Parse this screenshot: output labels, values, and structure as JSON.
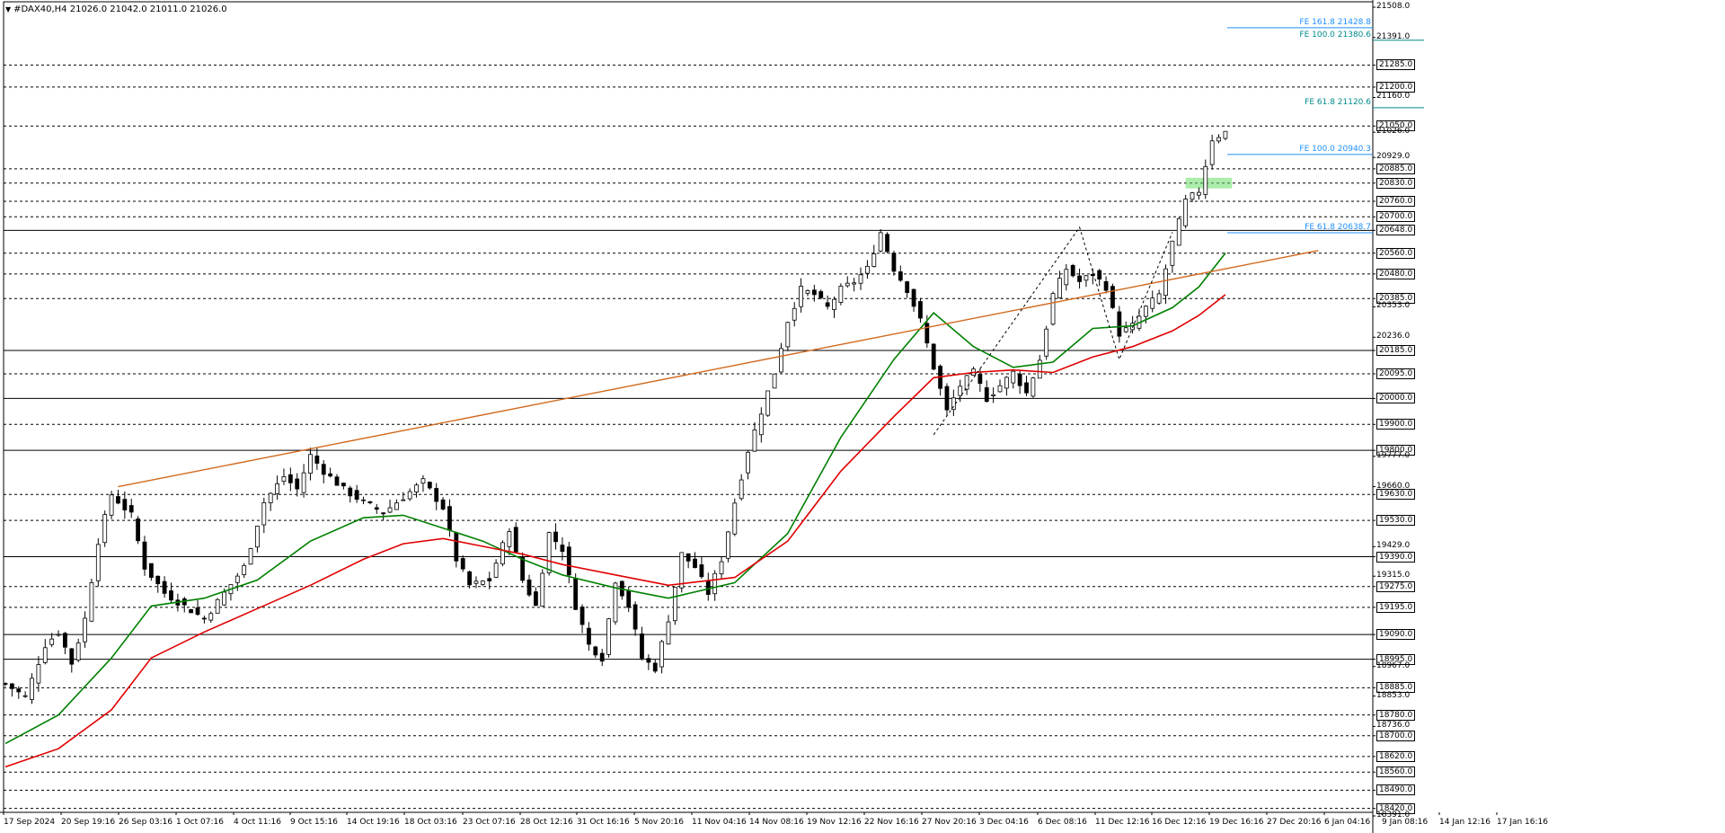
{
  "header": {
    "symbol_text": "#DAX40,H4  21026.0  21042.0  21011.0  21026.0"
  },
  "price_axis": {
    "labels": [
      {
        "text": "21508.0",
        "price": 21508.0,
        "boxed": false
      },
      {
        "text": "21391.0",
        "price": 21391.0,
        "boxed": false
      },
      {
        "text": "21285.0",
        "price": 21285.0,
        "boxed": true
      },
      {
        "text": "21200.0",
        "price": 21200.0,
        "boxed": true
      },
      {
        "text": "21160.0",
        "price": 21160.0,
        "boxed": false
      },
      {
        "text": "21050.0",
        "price": 21050.0,
        "boxed": true
      },
      {
        "text": "21026.0",
        "price": 21026.0,
        "boxed": false
      },
      {
        "text": "20929.0",
        "price": 20929.0,
        "boxed": false
      },
      {
        "text": "20885.0",
        "price": 20885.0,
        "boxed": true
      },
      {
        "text": "20830.0",
        "price": 20830.0,
        "boxed": true
      },
      {
        "text": "20760.0",
        "price": 20760.0,
        "boxed": true
      },
      {
        "text": "20700.0",
        "price": 20700.0,
        "boxed": true
      },
      {
        "text": "20648.0",
        "price": 20648.0,
        "boxed": true
      },
      {
        "text": "20560.0",
        "price": 20560.0,
        "boxed": true
      },
      {
        "text": "20480.0",
        "price": 20480.0,
        "boxed": true
      },
      {
        "text": "20385.0",
        "price": 20385.0,
        "boxed": true
      },
      {
        "text": "20353.0",
        "price": 20353.0,
        "boxed": false
      },
      {
        "text": "20236.0",
        "price": 20236.0,
        "boxed": false
      },
      {
        "text": "20185.0",
        "price": 20185.0,
        "boxed": true
      },
      {
        "text": "20095.0",
        "price": 20095.0,
        "boxed": true
      },
      {
        "text": "20000.0",
        "price": 20000.0,
        "boxed": true
      },
      {
        "text": "19900.0",
        "price": 19900.0,
        "boxed": true
      },
      {
        "text": "19800.0",
        "price": 19800.0,
        "boxed": true
      },
      {
        "text": "19777.0",
        "price": 19777.0,
        "boxed": false
      },
      {
        "text": "19660.0",
        "price": 19660.0,
        "boxed": false
      },
      {
        "text": "19630.0",
        "price": 19630.0,
        "boxed": true
      },
      {
        "text": "19530.0",
        "price": 19530.0,
        "boxed": true
      },
      {
        "text": "19429.0",
        "price": 19429.0,
        "boxed": false
      },
      {
        "text": "19390.0",
        "price": 19390.0,
        "boxed": true
      },
      {
        "text": "19315.0",
        "price": 19315.0,
        "boxed": false
      },
      {
        "text": "19275.0",
        "price": 19275.0,
        "boxed": true
      },
      {
        "text": "19195.0",
        "price": 19195.0,
        "boxed": true
      },
      {
        "text": "19090.0",
        "price": 19090.0,
        "boxed": true
      },
      {
        "text": "18995.0",
        "price": 18995.0,
        "boxed": true
      },
      {
        "text": "18967.0",
        "price": 18967.0,
        "boxed": false
      },
      {
        "text": "18885.0",
        "price": 18885.0,
        "boxed": true
      },
      {
        "text": "18853.0",
        "price": 18853.0,
        "boxed": false
      },
      {
        "text": "18780.0",
        "price": 18780.0,
        "boxed": true
      },
      {
        "text": "18736.0",
        "price": 18736.0,
        "boxed": false
      },
      {
        "text": "18700.0",
        "price": 18700.0,
        "boxed": true
      },
      {
        "text": "18620.0",
        "price": 18620.0,
        "boxed": true
      },
      {
        "text": "18560.0",
        "price": 18560.0,
        "boxed": true
      },
      {
        "text": "18490.0",
        "price": 18490.0,
        "boxed": true
      },
      {
        "text": "18420.0",
        "price": 18420.0,
        "boxed": true
      },
      {
        "text": "18391.0",
        "price": 18391.0,
        "boxed": false
      }
    ]
  },
  "time_axis": {
    "labels": [
      "17 Sep 2024",
      "20 Sep 19:16",
      "26 Sep 03:16",
      "1 Oct 07:16",
      "4 Oct 11:16",
      "9 Oct 15:16",
      "14 Oct 19:16",
      "18 Oct 03:16",
      "23 Oct 07:16",
      "28 Oct 12:16",
      "31 Oct 16:16",
      "5 Nov 20:16",
      "11 Nov 04:16",
      "14 Nov 08:16",
      "19 Nov 12:16",
      "22 Nov 16:16",
      "27 Nov 20:16",
      "3 Dec 04:16",
      "6 Dec 08:16",
      "11 Dec 12:16",
      "16 Dec 12:16",
      "19 Dec 16:16",
      "27 Dec 20:16",
      "6 Jan 04:16",
      "9 Jan 08:16",
      "14 Jan 12:16",
      "17 Jan 16:16"
    ]
  },
  "levels": {
    "dashed": [
      21285,
      21200,
      21050,
      20885,
      20830,
      20760,
      20700,
      20560,
      20480,
      20385,
      20095,
      19900,
      19630,
      19530,
      19275,
      19195,
      18885,
      18780,
      18700,
      18620,
      18560,
      18490,
      18420
    ],
    "solid": [
      20648,
      20185,
      20000,
      19800,
      19390,
      19090,
      18995
    ]
  },
  "fibonacci": [
    {
      "text": "FE 161.8 21428.8",
      "price": 21428.8,
      "color": "#1e90ff"
    },
    {
      "text": "FE 100.0 21380.6",
      "price": 21380.6,
      "color": "#008b8b"
    },
    {
      "text": "FE 61.8 21120.6",
      "price": 21120.6,
      "color": "#008b8b"
    },
    {
      "text": "FE 100.0 20940.3",
      "price": 20940.3,
      "color": "#1e90ff"
    },
    {
      "text": "FE 61.8 20638.7",
      "price": 20638.7,
      "color": "#1e90ff"
    }
  ],
  "colors": {
    "bull_candle": "#000000",
    "bear_candle": "#000000",
    "ma_fast": "#008000",
    "ma_slow": "#e00000",
    "trendline": "#d2691e",
    "zone": "#66dd66",
    "fib_blue": "#1e90ff",
    "fib_teal": "#008b8b"
  },
  "chart_data": {
    "type": "candlestick",
    "symbol": "#DAX40",
    "timeframe": "H4",
    "ylim": [
      18391,
      21508
    ],
    "last_bar": {
      "open": 21026.0,
      "high": 21042.0,
      "low": 21011.0,
      "close": 21026.0
    },
    "price_path": [
      [
        0,
        18900
      ],
      [
        3,
        18850
      ],
      [
        6,
        19050
      ],
      [
        8,
        19100
      ],
      [
        10,
        18980
      ],
      [
        12,
        19150
      ],
      [
        14,
        19450
      ],
      [
        16,
        19630
      ],
      [
        19,
        19550
      ],
      [
        21,
        19350
      ],
      [
        24,
        19250
      ],
      [
        27,
        19200
      ],
      [
        30,
        19150
      ],
      [
        33,
        19250
      ],
      [
        36,
        19350
      ],
      [
        39,
        19600
      ],
      [
        42,
        19700
      ],
      [
        44,
        19650
      ],
      [
        46,
        19780
      ],
      [
        48,
        19720
      ],
      [
        51,
        19650
      ],
      [
        54,
        19600
      ],
      [
        57,
        19560
      ],
      [
        60,
        19620
      ],
      [
        63,
        19680
      ],
      [
        66,
        19580
      ],
      [
        68,
        19380
      ],
      [
        70,
        19280
      ],
      [
        73,
        19300
      ],
      [
        76,
        19500
      ],
      [
        78,
        19300
      ],
      [
        80,
        19200
      ],
      [
        82,
        19480
      ],
      [
        84,
        19420
      ],
      [
        86,
        19200
      ],
      [
        88,
        19050
      ],
      [
        90,
        19000
      ],
      [
        92,
        19300
      ],
      [
        94,
        19200
      ],
      [
        96,
        19000
      ],
      [
        98,
        18960
      ],
      [
        100,
        19150
      ],
      [
        102,
        19400
      ],
      [
        104,
        19350
      ],
      [
        106,
        19250
      ],
      [
        108,
        19380
      ],
      [
        110,
        19600
      ],
      [
        112,
        19800
      ],
      [
        114,
        19950
      ],
      [
        116,
        20100
      ],
      [
        118,
        20300
      ],
      [
        120,
        20420
      ],
      [
        122,
        20400
      ],
      [
        124,
        20350
      ],
      [
        126,
        20420
      ],
      [
        128,
        20450
      ],
      [
        130,
        20500
      ],
      [
        132,
        20640
      ],
      [
        134,
        20500
      ],
      [
        136,
        20420
      ],
      [
        138,
        20300
      ],
      [
        140,
        20120
      ],
      [
        142,
        19950
      ],
      [
        144,
        20050
      ],
      [
        146,
        20100
      ],
      [
        148,
        20000
      ],
      [
        150,
        20050
      ],
      [
        152,
        20100
      ],
      [
        154,
        20020
      ],
      [
        156,
        20150
      ],
      [
        158,
        20400
      ],
      [
        160,
        20500
      ],
      [
        162,
        20450
      ],
      [
        164,
        20480
      ],
      [
        166,
        20430
      ],
      [
        168,
        20250
      ],
      [
        170,
        20280
      ],
      [
        172,
        20350
      ],
      [
        174,
        20400
      ],
      [
        176,
        20600
      ],
      [
        178,
        20760
      ],
      [
        180,
        20800
      ],
      [
        182,
        21000
      ],
      [
        184,
        21026
      ]
    ],
    "ma_fast": [
      [
        0,
        18670
      ],
      [
        8,
        18780
      ],
      [
        16,
        19000
      ],
      [
        22,
        19200
      ],
      [
        30,
        19230
      ],
      [
        38,
        19300
      ],
      [
        46,
        19450
      ],
      [
        54,
        19540
      ],
      [
        60,
        19550
      ],
      [
        66,
        19500
      ],
      [
        72,
        19450
      ],
      [
        78,
        19380
      ],
      [
        84,
        19320
      ],
      [
        92,
        19270
      ],
      [
        100,
        19230
      ],
      [
        110,
        19290
      ],
      [
        118,
        19480
      ],
      [
        126,
        19850
      ],
      [
        134,
        20150
      ],
      [
        140,
        20330
      ],
      [
        146,
        20200
      ],
      [
        152,
        20120
      ],
      [
        158,
        20140
      ],
      [
        164,
        20270
      ],
      [
        170,
        20280
      ],
      [
        176,
        20350
      ],
      [
        180,
        20430
      ],
      [
        184,
        20560
      ]
    ],
    "ma_slow": [
      [
        0,
        18580
      ],
      [
        8,
        18650
      ],
      [
        16,
        18800
      ],
      [
        22,
        19000
      ],
      [
        30,
        19100
      ],
      [
        38,
        19190
      ],
      [
        46,
        19280
      ],
      [
        54,
        19380
      ],
      [
        60,
        19440
      ],
      [
        66,
        19460
      ],
      [
        72,
        19430
      ],
      [
        78,
        19400
      ],
      [
        84,
        19360
      ],
      [
        92,
        19320
      ],
      [
        100,
        19280
      ],
      [
        110,
        19310
      ],
      [
        118,
        19450
      ],
      [
        126,
        19720
      ],
      [
        134,
        19930
      ],
      [
        140,
        20080
      ],
      [
        146,
        20100
      ],
      [
        152,
        20110
      ],
      [
        158,
        20100
      ],
      [
        164,
        20160
      ],
      [
        170,
        20200
      ],
      [
        176,
        20260
      ],
      [
        180,
        20320
      ],
      [
        184,
        20400
      ]
    ],
    "trendline": {
      "from": [
        17,
        19660
      ],
      "to": [
        198,
        20570
      ]
    },
    "zone": {
      "from_bar": 178,
      "to_bar": 185,
      "low": 20820,
      "high": 20840
    }
  }
}
